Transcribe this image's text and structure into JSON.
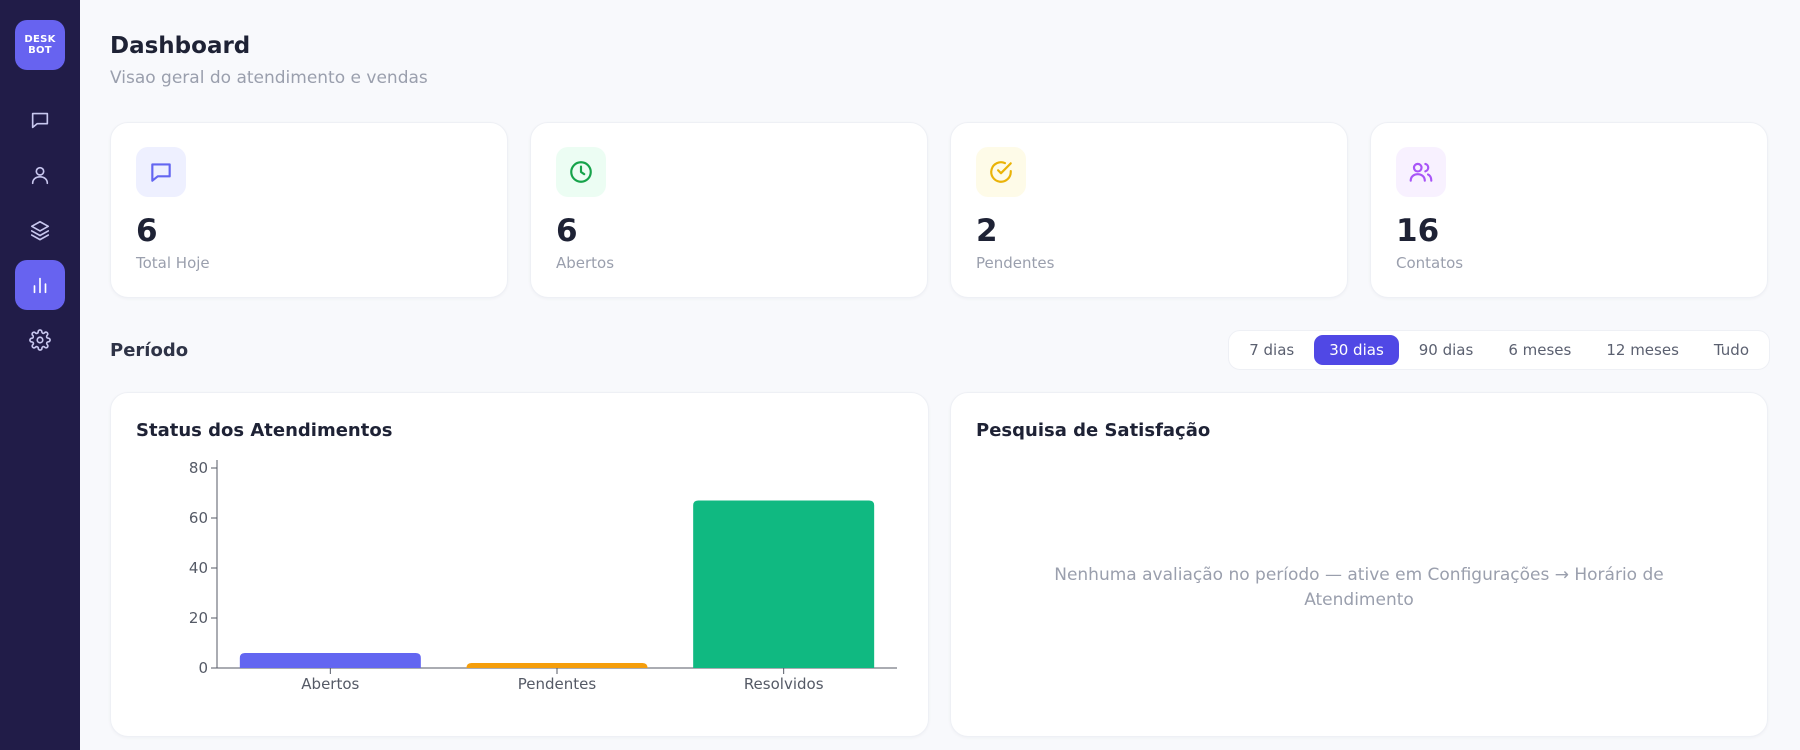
{
  "sidebar": {
    "logo_line1": "DESK",
    "logo_line2": "BOT",
    "items": [
      {
        "icon": "chat-icon"
      },
      {
        "icon": "user-icon"
      },
      {
        "icon": "layers-icon"
      },
      {
        "icon": "bar-chart-icon",
        "active": true
      },
      {
        "icon": "gear-icon"
      }
    ]
  },
  "header": {
    "title": "Dashboard",
    "subtitle": "Visao geral do atendimento e vendas"
  },
  "stats": [
    {
      "value": "6",
      "label": "Total Hoje",
      "icon": "chat-icon",
      "color": "#6366f1",
      "bg": "#eef0ff"
    },
    {
      "value": "6",
      "label": "Abertos",
      "icon": "clock-icon",
      "color": "#16a34a",
      "bg": "#ecfdf3"
    },
    {
      "value": "2",
      "label": "Pendentes",
      "icon": "check-circle-icon",
      "color": "#eab308",
      "bg": "#fefbe8"
    },
    {
      "value": "16",
      "label": "Contatos",
      "icon": "users-icon",
      "color": "#a855f7",
      "bg": "#f8f1ff"
    }
  ],
  "period": {
    "label": "Período",
    "options": [
      "7 dias",
      "30 dias",
      "90 dias",
      "6 meses",
      "12 meses",
      "Tudo"
    ],
    "selected": "30 dias"
  },
  "status_panel": {
    "title": "Status dos Atendimentos"
  },
  "satisfaction_panel": {
    "title": "Pesquisa de Satisfação",
    "empty_message": "Nenhuma avaliação no período — ative em Configurações → Horário de Atendimento"
  },
  "chart_data": {
    "type": "bar",
    "categories": [
      "Abertos",
      "Pendentes",
      "Resolvidos"
    ],
    "values": [
      6,
      2,
      67
    ],
    "colors": [
      "#6366f1",
      "#f59e0b",
      "#10b981"
    ],
    "yticks": [
      0,
      20,
      40,
      60,
      80
    ],
    "ylim": [
      0,
      80
    ],
    "grid": false
  }
}
